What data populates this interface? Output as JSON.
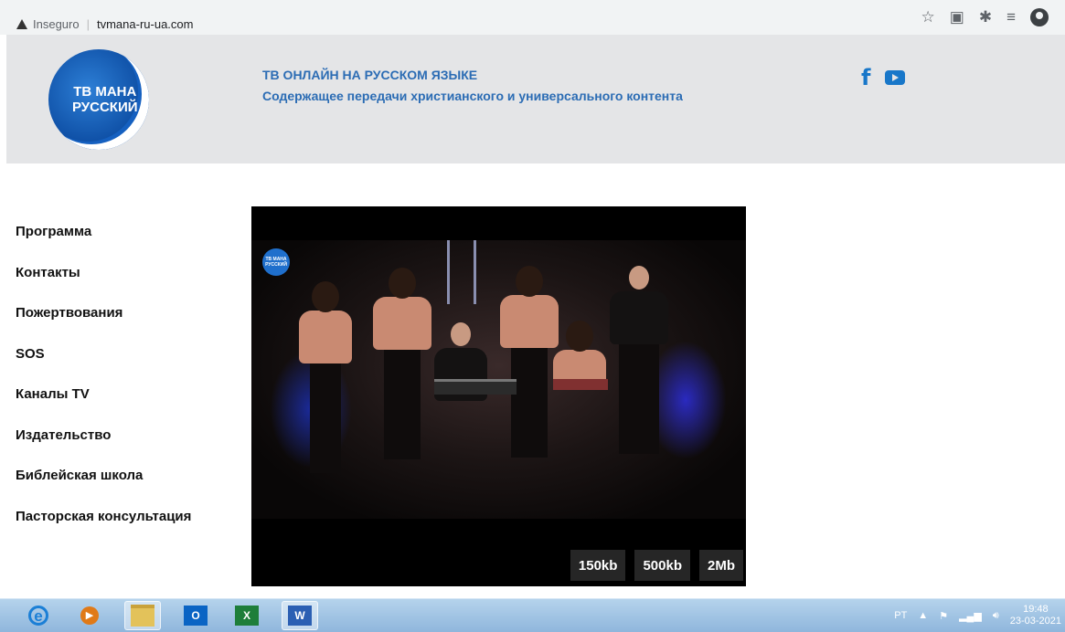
{
  "browser": {
    "security_label": "Inseguro",
    "url": "tvmana-ru-ua.com",
    "toolbar_icons": [
      "star-icon",
      "pdf-extension-icon",
      "puzzle-extension-icon",
      "reading-list-icon",
      "profile-avatar-icon"
    ]
  },
  "header": {
    "logo_line1": "ТВ МАНА",
    "logo_line2": "РУССКИЙ",
    "title": "ТВ ОНЛАЙН НА РУССКОМ ЯЗЫКЕ",
    "subtitle": "Содержащее передачи христианского и универсального контента",
    "social": [
      "facebook-icon",
      "youtube-icon"
    ],
    "facebook_glyph": "f"
  },
  "nav": {
    "items": [
      {
        "label": "Программа"
      },
      {
        "label": "Контакты"
      },
      {
        "label": "Пожертвования"
      },
      {
        "label": "SOS"
      },
      {
        "label": "Каналы TV"
      },
      {
        "label": "Издательство"
      },
      {
        "label": "Библейская школа"
      },
      {
        "label": "Пасторская консультация"
      }
    ]
  },
  "player": {
    "mini_logo_line1": "ТВ МАНА",
    "mini_logo_line2": "РУССКИЙ",
    "quality_options": [
      "150kb",
      "500kb",
      "2Mb"
    ]
  },
  "taskbar": {
    "apps": [
      "internet-explorer-icon",
      "media-player-icon",
      "file-explorer-icon",
      "outlook-icon",
      "excel-icon",
      "word-icon"
    ],
    "outlook_label": "O",
    "excel_label": "X",
    "word_label": "W",
    "language": "PT",
    "time": "19:48",
    "date": "23-03-2021"
  },
  "colors": {
    "header_bg": "#e4e5e7",
    "header_text": "#2b6cb4",
    "social_blue": "#1877c9",
    "taskbar": "#9fc3e4"
  }
}
